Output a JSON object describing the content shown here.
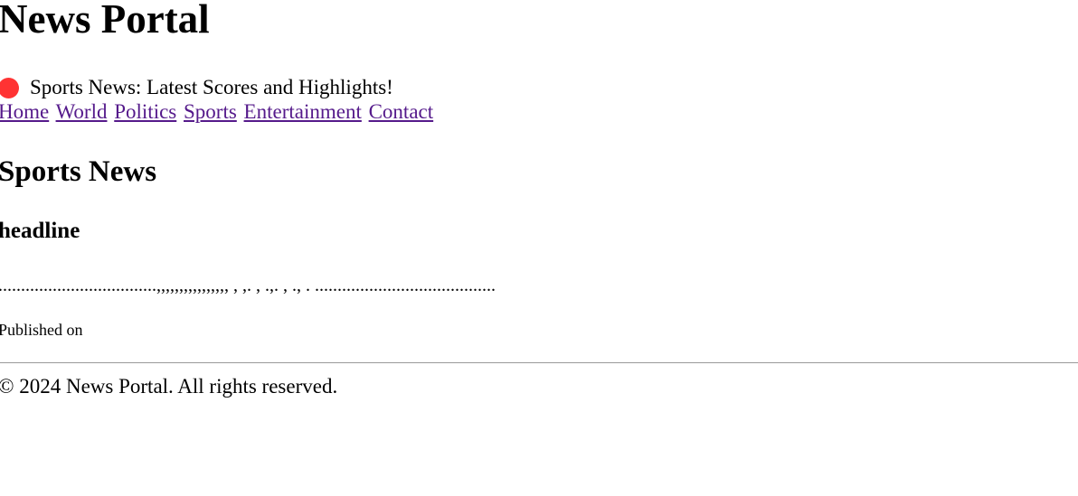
{
  "header": {
    "title": "News Portal"
  },
  "ticker": {
    "text": "Sports News: Latest Scores and Highlights!",
    "dot_color": "#ff3333"
  },
  "nav": {
    "items": [
      {
        "label": "Home"
      },
      {
        "label": "World"
      },
      {
        "label": "Politics"
      },
      {
        "label": "Sports"
      },
      {
        "label": "Entertainment"
      },
      {
        "label": "Contact"
      }
    ],
    "link_color": "#551a8b"
  },
  "main": {
    "section_title": "Sports News",
    "article": {
      "headline": "headline",
      "body": "...................................,,,,,,,,,,,,,,,, , ,. , .,. , ., . ........................................",
      "published": "Published on"
    }
  },
  "footer": {
    "text": "© 2024 News Portal. All rights reserved."
  }
}
